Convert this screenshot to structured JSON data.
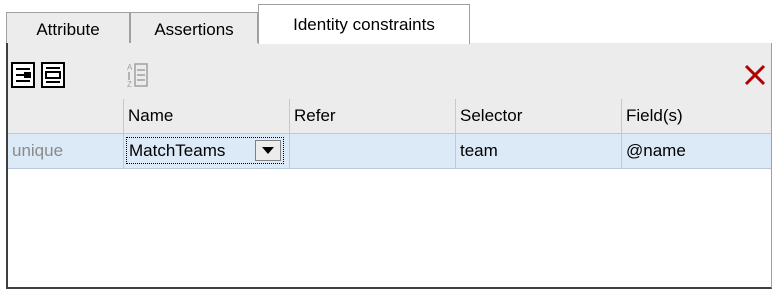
{
  "tabs": [
    {
      "label": "Attribute"
    },
    {
      "label": "Assertions"
    },
    {
      "label": "Identity constraints"
    }
  ],
  "icons": {
    "append": "append-constraint-icon",
    "insert": "insert-constraint-icon",
    "sort": "sort-az-icon",
    "delete": "delete-icon",
    "dropdown": "dropdown-arrow-icon"
  },
  "colors": {
    "delete_icon": "#b00000",
    "selected_row": "#dce9f7",
    "kind_text": "#8a8a8a"
  },
  "table": {
    "columns": [
      "",
      "Name",
      "Refer",
      "Selector",
      "Field(s)"
    ],
    "rows": [
      {
        "kind": "unique",
        "name": "MatchTeams",
        "refer": "",
        "selector": "team",
        "fields": "@name"
      }
    ]
  }
}
